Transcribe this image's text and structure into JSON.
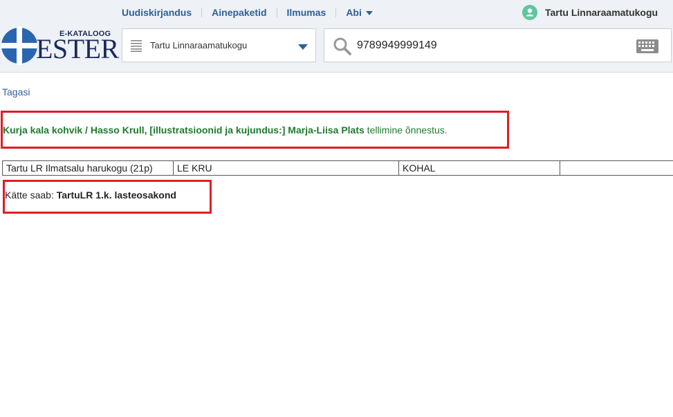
{
  "nav": {
    "items": [
      {
        "label": "Uudiskirjandus"
      },
      {
        "label": "Ainepaketid"
      },
      {
        "label": "Ilmumas"
      },
      {
        "label": "Abi"
      }
    ]
  },
  "user": {
    "name": "Tartu Linnaraamatukogu"
  },
  "logo": {
    "small_text": "E-KATALOOG",
    "big_text": "ESTER"
  },
  "library_select": {
    "value": "Tartu Linnaraamatukogu"
  },
  "search": {
    "value": "9789949999149"
  },
  "back_link": "Tagasi",
  "order": {
    "title": "Kurja kala kohvik / Hasso Krull, [illustratsioonid ja kujundus:] Marja-Liisa Plats",
    "status": " tellimine õnnestus."
  },
  "copy": {
    "cells": [
      "Tartu LR Ilmatsalu harukogu (21p)",
      "LE KRU",
      "KOHAL",
      ""
    ]
  },
  "pickup": {
    "label": "Kätte saab: ",
    "place": "TartuLR 1.k. lasteosakond"
  },
  "colors": {
    "link": "#2f5f99",
    "success": "#1e7b2c",
    "highlight_border": "#e01c24",
    "avatar": "#5fc6a0"
  }
}
